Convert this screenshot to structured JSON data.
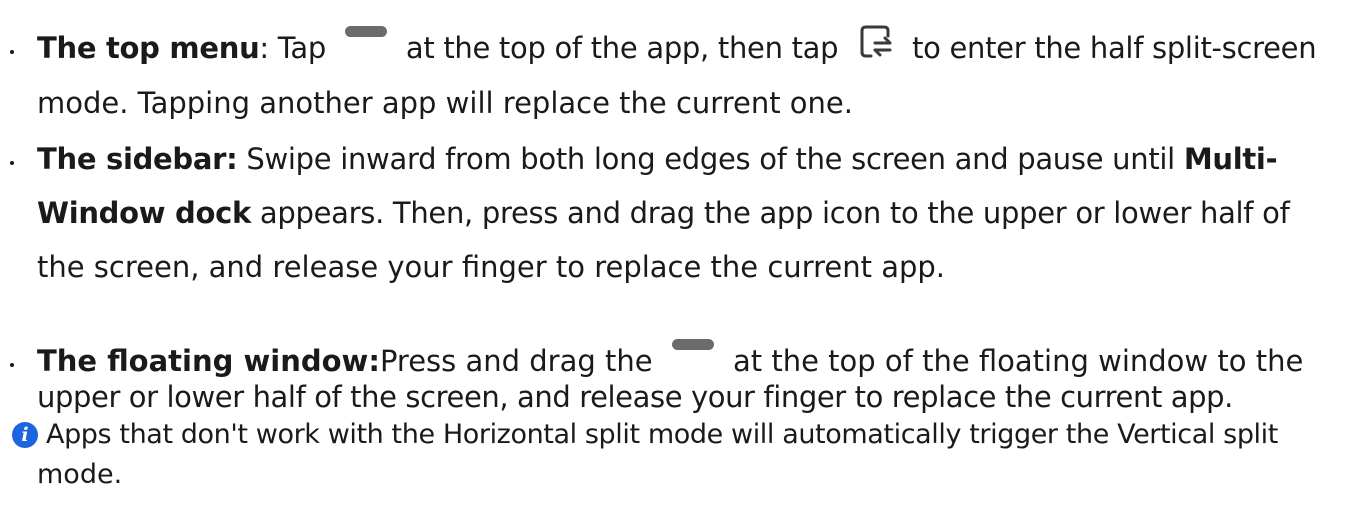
{
  "items": [
    {
      "title": "The top menu",
      "line1_a": ": Tap",
      "line1_b": "at the top of the app, then tap",
      "line1_c": "to enter the half split-screen",
      "line2": "mode. Tapping another app will replace the current one.",
      "icons": [
        "handle-icon",
        "split-screen-icon"
      ]
    },
    {
      "title": "The sidebar:",
      "line1_a": " Swipe inward from both long edges of the screen and pause until ",
      "line1_bold": "Multi-",
      "line2_bold": "Window dock",
      "line2_rest": " appears. Then, press and drag the app icon to the upper or lower half of",
      "line3": "the screen, and release your finger to replace the current app."
    },
    {
      "title": "The floating window:",
      "line1_a": "Press and drag the",
      "line1_b": "at the top of the floating window to the",
      "line2": "upper or lower half of the screen, and release your finger to replace the current app.",
      "icons": [
        "handle-icon"
      ]
    }
  ],
  "note": {
    "icon": "info-icon",
    "icon_glyph": "i",
    "line1": "Apps that don't work with the Horizontal split mode will automatically trigger the Vertical split",
    "line2": "mode."
  },
  "colors": {
    "text": "#1a1a1a",
    "icon_gray": "#6b6b6b",
    "info_blue": "#1e63e0"
  }
}
